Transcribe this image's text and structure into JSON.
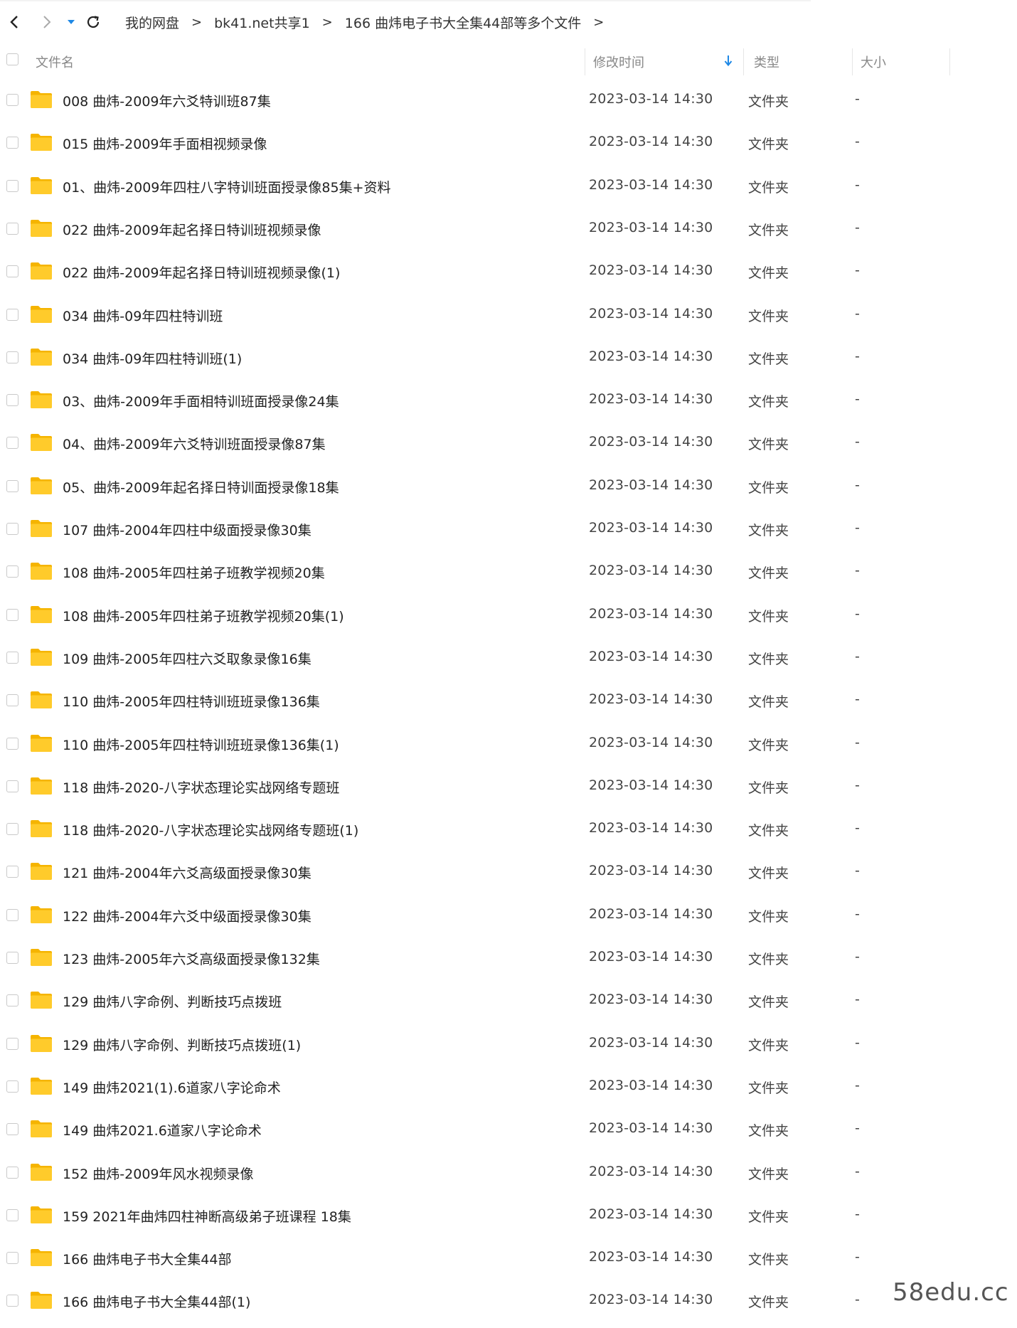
{
  "breadcrumb": [
    "我的网盘",
    "bk41.net共享1",
    "166 曲炜电子书大全集44部等多个文件"
  ],
  "breadcrumb_separator": ">",
  "nav": {
    "back_icon": "chevron-left-icon",
    "forward_icon": "chevron-right-icon",
    "history_icon": "caret-down-icon",
    "refresh_icon": "refresh-icon"
  },
  "columns": {
    "name": "文件名",
    "modified": "修改时间",
    "type": "类型",
    "size": "大小"
  },
  "colors": {
    "folder": "#FFCB2B",
    "folder_back": "#F5B400",
    "sort_arrow": "#1E88E5"
  },
  "files": [
    {
      "name": "008 曲炜-2009年六爻特训班87集",
      "modified": "2023-03-14 14:30",
      "type": "文件夹",
      "size": "-"
    },
    {
      "name": "015 曲炜-2009年手面相视频录像",
      "modified": "2023-03-14 14:30",
      "type": "文件夹",
      "size": "-"
    },
    {
      "name": "01、曲炜-2009年四柱八字特训班面授录像85集+资料",
      "modified": "2023-03-14 14:30",
      "type": "文件夹",
      "size": "-"
    },
    {
      "name": "022 曲炜-2009年起名择日特训班视频录像",
      "modified": "2023-03-14 14:30",
      "type": "文件夹",
      "size": "-"
    },
    {
      "name": "022 曲炜-2009年起名择日特训班视频录像(1)",
      "modified": "2023-03-14 14:30",
      "type": "文件夹",
      "size": "-"
    },
    {
      "name": "034 曲炜-09年四柱特训班",
      "modified": "2023-03-14 14:30",
      "type": "文件夹",
      "size": "-"
    },
    {
      "name": "034 曲炜-09年四柱特训班(1)",
      "modified": "2023-03-14 14:30",
      "type": "文件夹",
      "size": "-"
    },
    {
      "name": "03、曲炜-2009年手面相特训班面授录像24集",
      "modified": "2023-03-14 14:30",
      "type": "文件夹",
      "size": "-"
    },
    {
      "name": "04、曲炜-2009年六爻特训班面授录像87集",
      "modified": "2023-03-14 14:30",
      "type": "文件夹",
      "size": "-"
    },
    {
      "name": "05、曲炜-2009年起名择日特训面授录像18集",
      "modified": "2023-03-14 14:30",
      "type": "文件夹",
      "size": "-"
    },
    {
      "name": "107 曲炜-2004年四柱中级面授录像30集",
      "modified": "2023-03-14 14:30",
      "type": "文件夹",
      "size": "-"
    },
    {
      "name": "108 曲炜-2005年四柱弟子班教学视频20集",
      "modified": "2023-03-14 14:30",
      "type": "文件夹",
      "size": "-"
    },
    {
      "name": "108 曲炜-2005年四柱弟子班教学视频20集(1)",
      "modified": "2023-03-14 14:30",
      "type": "文件夹",
      "size": "-"
    },
    {
      "name": "109 曲炜-2005年四柱六爻取象录像16集",
      "modified": "2023-03-14 14:30",
      "type": "文件夹",
      "size": "-"
    },
    {
      "name": "110 曲炜-2005年四柱特训班班录像136集",
      "modified": "2023-03-14 14:30",
      "type": "文件夹",
      "size": "-"
    },
    {
      "name": "110 曲炜-2005年四柱特训班班录像136集(1)",
      "modified": "2023-03-14 14:30",
      "type": "文件夹",
      "size": "-"
    },
    {
      "name": "118 曲炜-2020-八字状态理论实战网络专题班",
      "modified": "2023-03-14 14:30",
      "type": "文件夹",
      "size": "-"
    },
    {
      "name": "118 曲炜-2020-八字状态理论实战网络专题班(1)",
      "modified": "2023-03-14 14:30",
      "type": "文件夹",
      "size": "-"
    },
    {
      "name": "121 曲炜-2004年六爻高级面授录像30集",
      "modified": "2023-03-14 14:30",
      "type": "文件夹",
      "size": "-"
    },
    {
      "name": "122 曲炜-2004年六爻中级面授录像30集",
      "modified": "2023-03-14 14:30",
      "type": "文件夹",
      "size": "-"
    },
    {
      "name": "123 曲炜-2005年六爻高级面授录像132集",
      "modified": "2023-03-14 14:30",
      "type": "文件夹",
      "size": "-"
    },
    {
      "name": "129 曲炜八字命例、判断技巧点拨班",
      "modified": "2023-03-14 14:30",
      "type": "文件夹",
      "size": "-"
    },
    {
      "name": "129 曲炜八字命例、判断技巧点拨班(1)",
      "modified": "2023-03-14 14:30",
      "type": "文件夹",
      "size": "-"
    },
    {
      "name": "149 曲炜2021(1).6道家八字论命术",
      "modified": "2023-03-14 14:30",
      "type": "文件夹",
      "size": "-"
    },
    {
      "name": "149 曲炜2021.6道家八字论命术",
      "modified": "2023-03-14 14:30",
      "type": "文件夹",
      "size": "-"
    },
    {
      "name": "152 曲炜-2009年风水视频录像",
      "modified": "2023-03-14 14:30",
      "type": "文件夹",
      "size": "-"
    },
    {
      "name": "159  2021年曲炜四柱神断高级弟子班课程 18集",
      "modified": "2023-03-14 14:30",
      "type": "文件夹",
      "size": "-"
    },
    {
      "name": "166 曲炜电子书大全集44部",
      "modified": "2023-03-14 14:30",
      "type": "文件夹",
      "size": "-"
    },
    {
      "name": "166 曲炜电子书大全集44部(1)",
      "modified": "2023-03-14 14:30",
      "type": "文件夹",
      "size": "-"
    }
  ],
  "watermark": "58edu.cc"
}
